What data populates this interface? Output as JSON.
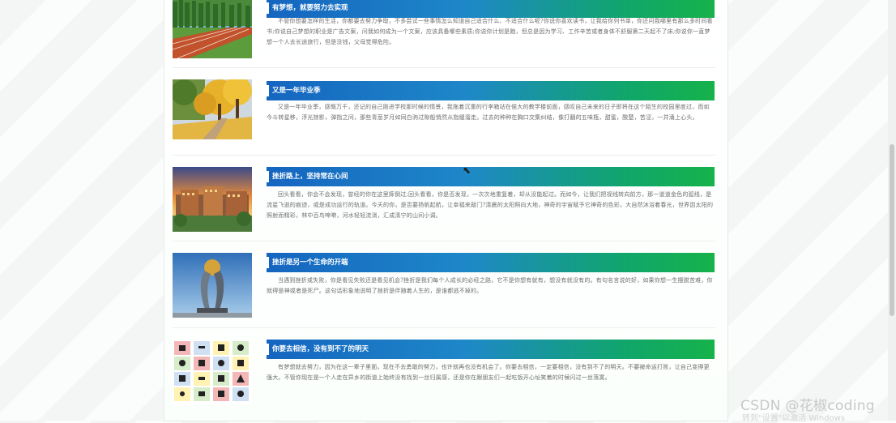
{
  "articles": [
    {
      "title": "有梦想，就要努力去实现",
      "thumb_icon": "running-track-image",
      "text": "不管你想要怎样的生活，你都要去努力争取，不多尝试一些事情怎么知道自己适合什么、不适合什么呢?你说你喜欢读书，让我给你列书单，你还问我哪里有那么多时间看书;你说自己梦想的职业是广告文案，问我如何成为一个文案，应该具备哪些素质;你说你计划是跑，但总是因为学习、工作辛苦或者身体不舒服第二天起不了床;你说你一直梦想一个人去长途旅行，但是没钱，父母觉得危险。"
    },
    {
      "title": "又是一年毕业季",
      "thumb_icon": "autumn-campus-image",
      "text": "又是一年毕业季，感慨万千，还记的自己刚进学校那时候的情景，我拖着沉重的行李箱站在偌大的教学楼前面，感叹自己未来的日子即将在这个陌生的校园里度过，而如今斗转星移，浮光掠影，弹指之间，那些青葱岁月如同白驹过隙般悄然从指缝溜走。过去的种种在胸口交集纠结，像打翻的五味瓶，甜蜜，酸楚，苦涩，一并涌上心头。"
    },
    {
      "title": "挫折路上，坚持常在心间",
      "thumb_icon": "sunset-building-image",
      "text": "回头看看，你会不会发现，曾经的你在这里摔倒过;回头看看，你是否发现，一次次地重复着，却从没能起过。而如今，让我们把视线转向前方，那一道道金色的弧线，是流星飞逝的痕迹，或是成功运行的轨道。今天的你，是否要扬帆起航，让幸福来敲门?清晨的太阳照向大地，神奇的宇宙赋予它神奇的色彩，大自然沐浴着春光，世界因太阳的照射而精彩，林中百鸟啼啭，河水轻轻流淌，汇成清宁的山间小调。"
    },
    {
      "title": "挫折是另一个生命的开端",
      "thumb_icon": "globe-sculpture-image",
      "text": "当遇到挫折或失败，你是看见失败还是看见机会?挫折是我们每个人成长的必经之路，它不是你想有就有，想没有就没有的。有句名言说的好，如果你想一生摆脱苦难，你就得是神或者是死尸。这句话形象地说明了挫折是伴随着人生的，是谁都逃不掉的。"
    },
    {
      "title": "你要去相信，没有到不了的明天",
      "thumb_icon": "icon-grid-image",
      "text": "有梦想就去努力，因为在这一辈子里面，现在不去勇敢的努力，也许就再也没有机会了。你要去相信，一定要相信，没有到不了的明天。不要被命运打败，让自己变得更强大。不管你现在是一个人走在异乡的街道上始终没有找到一丝归属感，还是你在跟朋友们一起吃饭开心址笑着的时候闪过一丝落寞。"
    }
  ],
  "watermark": "CSDN @花椒coding",
  "activation_text": "转到\"设置\"以激活 Windows"
}
